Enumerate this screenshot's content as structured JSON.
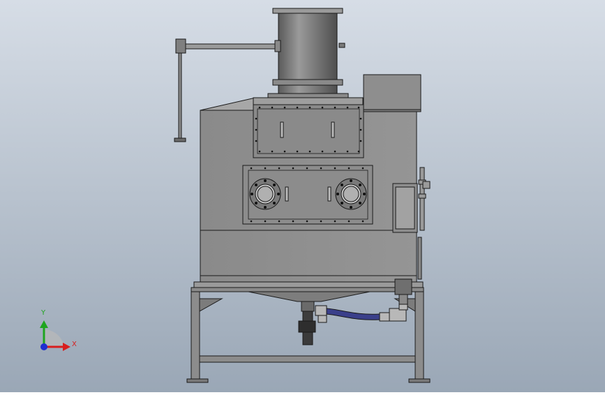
{
  "viewport": {
    "background_top": "#d6dde6",
    "background_bottom": "#9aa7b6"
  },
  "model": {
    "body_color": "#8e8e8e",
    "body_dark": "#6f6f6f",
    "edge_color": "#1a1a1a",
    "pipe_color": "#3a3f8a"
  },
  "triad": {
    "x_label": "X",
    "y_label": "Y",
    "x_color": "#d81e1e",
    "y_color": "#1fa51f",
    "z_color": "#1f2fd0"
  }
}
